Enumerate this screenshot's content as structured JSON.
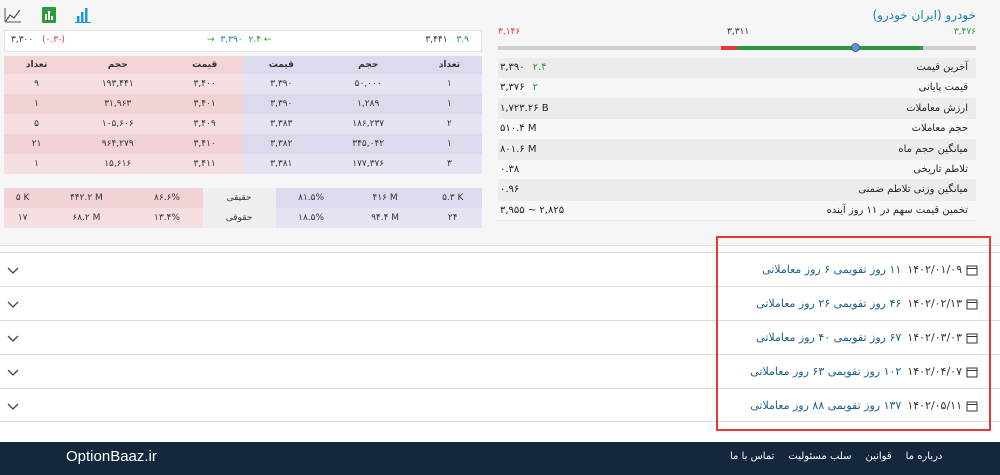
{
  "stock": {
    "title": "خودرو (ایران خودرو)",
    "range": {
      "high": "۳,۴۷۶",
      "close": "۳,۳۱۱",
      "low": "۳,۱۴۶"
    },
    "info": [
      {
        "label": "آخرین قیمت",
        "value": "۳,۳۹۰",
        "change": "۲.۴"
      },
      {
        "label": "قیمت پایانی",
        "value": "۳,۳۷۶",
        "change": "۲"
      },
      {
        "label": "ارزش معاملات",
        "value": "۱,۷۲۳.۲۶ B",
        "change": ""
      },
      {
        "label": "حجم معاملات",
        "value": "۵۱۰.۴ M",
        "change": ""
      },
      {
        "label": "میانگین حجم ماه",
        "value": "۸۰۱.۶ M",
        "change": ""
      },
      {
        "label": "تلاطم تاریخی",
        "value": "۰.۳۸",
        "change": ""
      },
      {
        "label": "میانگین وزنی تلاطم ضمنی",
        "value": "۰.۹۶",
        "change": ""
      },
      {
        "label": "تخمین قیمت سهم در ۱۱ روز آینده",
        "value": "۳,۹۵۵ ~ ۲,۸۲۵",
        "change": ""
      }
    ]
  },
  "chart_tools": [
    {
      "name": "line-chart-icon"
    },
    {
      "name": "spreadsheet-icon"
    },
    {
      "name": "bar-chart-icon"
    }
  ],
  "price_bar": {
    "left_value": "۳,۳۰۰",
    "left_change": "(۰.۳-)",
    "mid_value": "۳,۳۹۰",
    "mid_change": "۲.۴",
    "right_value": "۳,۴۴۱",
    "right_change": "۳.۹"
  },
  "orders": {
    "headers": [
      "تعداد",
      "حجم",
      "قیمت",
      "قیمت",
      "حجم",
      "تعداد"
    ],
    "rows": [
      [
        "۹",
        "۱۹۳,۴۴۱",
        "۳,۴۰۰",
        "۳,۳۹۰",
        "۵۰,۰۰۰",
        "۱"
      ],
      [
        "۱",
        "۳۱,۹۶۳",
        "۳,۴۰۱",
        "۳,۳۹۰",
        "۱,۲۸۹",
        "۱"
      ],
      [
        "۵",
        "۱۰۵,۶۰۶",
        "۳,۴۰۹",
        "۳,۳۸۳",
        "۱۸۶,۲۳۷",
        "۲"
      ],
      [
        "۲۱",
        "۹۶۴,۲۷۹",
        "۳,۴۱۰",
        "۳,۳۸۲",
        "۳۴۵,۰۴۲",
        "۱"
      ],
      [
        "۱",
        "۱۵,۶۱۶",
        "۳,۴۱۱",
        "۳,۳۸۱",
        "۱۷۷,۳۷۶",
        "۳"
      ]
    ]
  },
  "legal": {
    "rows": [
      [
        "۵ K",
        "۴۴۲.۲ M",
        "۸۶.۶%",
        "حقیقی",
        "۸۱.۵%",
        "۴۱۶ M",
        "۵.۳ K"
      ],
      [
        "۱۷",
        "۶۸.۲ M",
        "۱۳.۴%",
        "حقوقی",
        "۱۸.۵%",
        "۹۴.۴ M",
        "۲۴"
      ]
    ]
  },
  "accordion": [
    {
      "date": "۱۴۰۲/۰۱/۰۹",
      "detail": "۱۱ روز تقویمی ۶ روز معاملاتی"
    },
    {
      "date": "۱۴۰۲/۰۲/۱۳",
      "detail": "۴۶ روز تقویمی ۲۶ روز معاملاتی"
    },
    {
      "date": "۱۴۰۲/۰۳/۰۳",
      "detail": "۶۷ روز تقویمی ۴۰ روز معاملاتی"
    },
    {
      "date": "۱۴۰۲/۰۴/۰۷",
      "detail": "۱۰۲ روز تقویمی ۶۳ روز معاملاتی"
    },
    {
      "date": "۱۴۰۲/۰۵/۱۱",
      "detail": "۱۳۷ روز تقویمی ۸۸ روز معاملاتی"
    }
  ],
  "footer": {
    "brand": "OptionBaaz.ir",
    "links": [
      "درباره ما",
      "قوانین",
      "سلب مسئولیت",
      "تماس با ما"
    ]
  },
  "colors": {
    "accent_blue": "#1a7fb5",
    "positive": "#2a9d3a",
    "negative": "#e53935",
    "footer_bg": "#14273c"
  }
}
